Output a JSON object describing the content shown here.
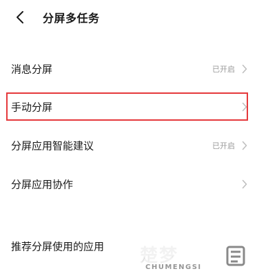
{
  "header": {
    "title": "分屏多任务"
  },
  "settings": [
    {
      "label": "消息分屏",
      "status": "已开启"
    },
    {
      "label": "手动分屏",
      "status": ""
    },
    {
      "label": "分屏应用智能建议",
      "status": "已开启"
    },
    {
      "label": "分屏应用协作",
      "status": ""
    },
    {
      "label": "推荐分屏使用的应用",
      "status": ""
    }
  ],
  "colors": {
    "highlight": "#e5383b",
    "chevron": "#bdbdbd",
    "status_text": "#9a9a9a"
  },
  "icons": {
    "back": "back-arrow-icon",
    "chevron": "chevron-right-icon"
  },
  "watermark": {
    "cn": "楚梦",
    "en": "CHUMENGSI"
  }
}
